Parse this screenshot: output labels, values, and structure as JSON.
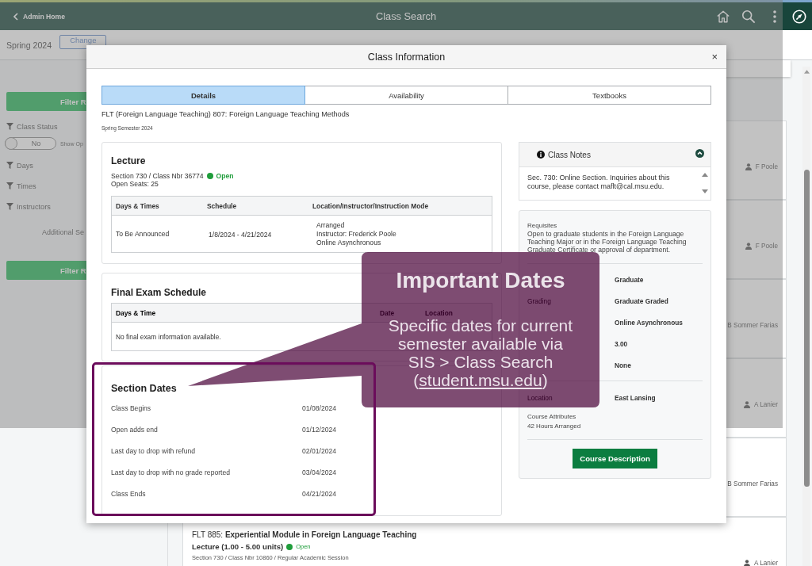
{
  "header": {
    "back_link": "Admin Home",
    "title": "Class Search"
  },
  "term_bar": {
    "term": "Spring 2024",
    "button": "Change"
  },
  "sidebar": {
    "items": [
      {
        "kind": "button",
        "label": "Filter R"
      },
      {
        "kind": "filter",
        "label": "Class Status"
      },
      {
        "kind": "toggle",
        "label": "No",
        "caption": "Show Op",
        "on": false
      },
      {
        "kind": "filter",
        "label": "Days"
      },
      {
        "kind": "filter",
        "label": "Times"
      },
      {
        "kind": "filter",
        "label": "Instructors"
      },
      {
        "kind": "text",
        "label": "Additional Se"
      },
      {
        "kind": "button",
        "label": "Filter R"
      }
    ]
  },
  "results": [
    {
      "instructor": "F Poole",
      "person_icon": true
    },
    {
      "instructor": "F Poole",
      "person_icon": true
    },
    {
      "instructor": "B Sommer Farias",
      "person_icon": false
    },
    {
      "instructor": "A Lanier",
      "person_icon": true
    },
    {
      "instructor": "B Sommer Farias",
      "person_icon": false
    },
    {
      "title": "FLT 885: **Experiential Module in Foreign Language Teaching**",
      "component": "Lecture (1.00 - 5.00 units)",
      "status": "Open",
      "details": "Section 730 / Class Nbr 10860 / Regular Academic Session",
      "instructor": "A Lanier",
      "person_icon": true
    }
  ],
  "modal": {
    "title": "Class Information",
    "close": "×",
    "tabs": [
      {
        "label": "Details",
        "selected": true
      },
      {
        "label": "Availability",
        "selected": false
      },
      {
        "label": "Textbooks",
        "selected": false
      }
    ],
    "course": "FLT (Foreign Language Teaching) 807: Foreign Language Teaching Methods",
    "term": "Spring Semester 2024",
    "lecture": {
      "heading": "Lecture",
      "section": "Section 730 / Class Nbr 36774",
      "status": "Open",
      "seats": "Open Seats: 25",
      "columns": [
        "Days & Times",
        "Schedule",
        "Location/Instructor/Instruction Mode"
      ],
      "rows": [
        {
          "days_times": "To Be Announced",
          "schedule": "1/8/2024 - 4/21/2024",
          "location": [
            "Arranged",
            "Instructor: Frederick Poole",
            "Online Asynchronous"
          ]
        }
      ]
    },
    "final_exam": {
      "heading": "Final Exam Schedule",
      "columns": [
        "Days & Time",
        "Date",
        "Location"
      ],
      "message": "No final exam information available."
    },
    "section_dates": {
      "heading": "Section Dates",
      "rows": [
        {
          "label": "Class Begins",
          "date": "01/08/2024"
        },
        {
          "label": "Open adds end",
          "date": "01/12/2024"
        },
        {
          "label": "Last day to drop with refund",
          "date": "02/01/2024"
        },
        {
          "label": "Last day to drop with no grade reported",
          "date": "03/04/2024"
        },
        {
          "label": "Class Ends",
          "date": "04/21/2024"
        }
      ]
    },
    "class_notes": {
      "heading": "Class Notes",
      "expanded": true,
      "text": "Sec. 730: Online Section. Inquiries about this course, please contact maflt@cal.msu.edu."
    },
    "details": {
      "requisites_label": "Requisites",
      "requisites": "Open to graduate students in the Foreign Language Teaching Major or in the Foreign Language Teaching Graduate Certificate or approval of department.",
      "fields": [
        {
          "value": "Graduate"
        },
        {
          "label": "Grading",
          "value": "Graduate Graded"
        },
        {
          "value": "Online Asynchronous"
        },
        {
          "value": "3.00"
        },
        {
          "value": "None"
        }
      ],
      "location": {
        "label": "Location",
        "value": "East Lansing"
      },
      "attributes_label": "Course Attributes",
      "attributes": "42 Hours Arranged",
      "button": "Course Description"
    }
  },
  "callout": {
    "title": "Important Dates",
    "text_before": "Specific dates for current semester available via SIS > Class Search (",
    "link": "student.msu.edu",
    "text_after": ")"
  }
}
